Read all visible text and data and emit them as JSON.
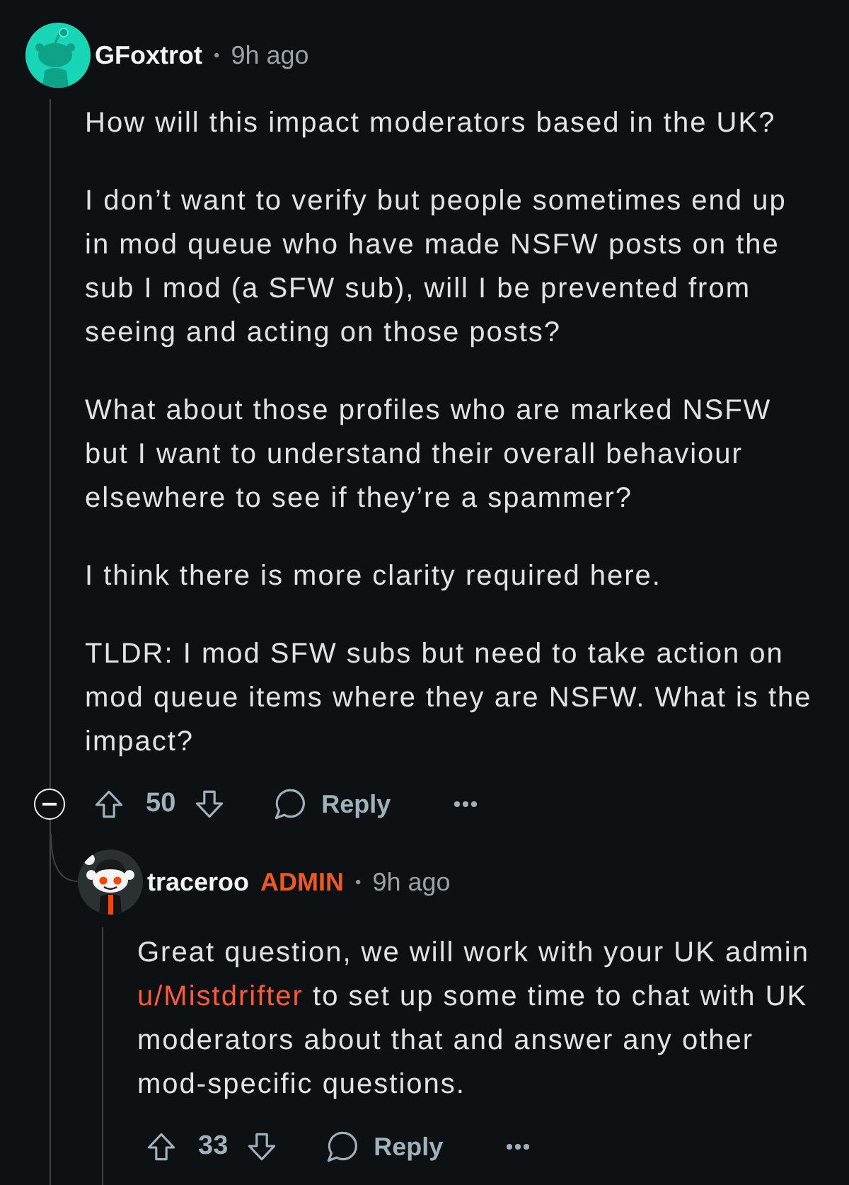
{
  "comment": {
    "author": "GFoxtrot",
    "separator": "•",
    "time": "9h ago",
    "paragraphs": [
      "How will this impact moderators based in the UK?",
      "I don’t want to verify but people sometimes end up in mod queue who have made NSFW posts on the sub I mod (a SFW sub), will I be prevented from seeing and acting on those posts?",
      "What about those profiles who are marked NSFW but I want to understand their overall behaviour elsewhere to see if they’re a spammer?",
      "I think there is more clarity required here.",
      "TLDR: I mod SFW subs but need to take action on mod queue items where they are NSFW. What is the impact?"
    ],
    "expanded": true,
    "score": "50",
    "reply_label": "Reply",
    "replies": [
      {
        "author": "traceroo",
        "role": "ADMIN",
        "separator": "•",
        "time": "9h ago",
        "body": [
          {
            "kind": "text",
            "text": "Great question, we will work with your UK admin "
          },
          {
            "kind": "link",
            "text": "u/Mistdrifter"
          },
          {
            "kind": "text",
            "text": " to set up some time to chat with UK moderators about that and answer any other mod-specific questions."
          }
        ],
        "score": "33",
        "reply_label": "Reply"
      }
    ]
  }
}
